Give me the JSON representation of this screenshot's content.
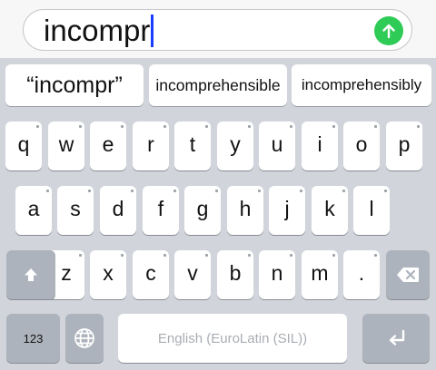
{
  "input": {
    "text": "incompr"
  },
  "suggestions": [
    "“incompr”",
    "incomprehensible",
    "incomprehensibly"
  ],
  "rows": [
    [
      "q",
      "w",
      "e",
      "r",
      "t",
      "y",
      "u",
      "i",
      "o",
      "p"
    ],
    [
      "a",
      "s",
      "d",
      "f",
      "g",
      "h",
      "j",
      "k",
      "l"
    ],
    [
      "z",
      "x",
      "c",
      "v",
      "b",
      "n",
      "m",
      "."
    ]
  ],
  "bottom": {
    "numbers_label": "123",
    "space_label": "English (EuroLatin (SIL))"
  },
  "icons": {
    "send": "arrow-up-icon",
    "shift": "shift-arrow-icon",
    "backspace": "backspace-icon",
    "globe": "globe-icon",
    "return": "return-icon"
  },
  "colors": {
    "send_button": "#2fcb57",
    "caret": "#1a3cff",
    "keyboard_bg": "#d1d4db",
    "function_key": "#adb3bc"
  }
}
